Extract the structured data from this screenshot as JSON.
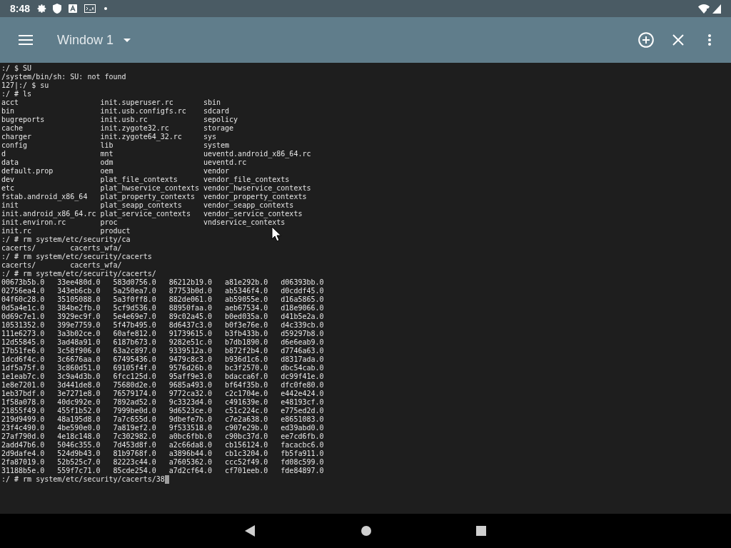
{
  "status_bar": {
    "time": "8:48"
  },
  "toolbar": {
    "title": "Window 1"
  },
  "terminal": {
    "blocks": [
      {
        "kind": "line",
        "text": ":/ $ SU"
      },
      {
        "kind": "line",
        "text": "/system/bin/sh: SU: not found"
      },
      {
        "kind": "line",
        "text": "127|:/ $ su"
      },
      {
        "kind": "line",
        "text": ":/ # ls"
      },
      {
        "kind": "listing",
        "rows": [
          [
            "acct",
            "init.superuser.rc",
            "sbin"
          ],
          [
            "bin",
            "init.usb.configfs.rc",
            "sdcard"
          ],
          [
            "bugreports",
            "init.usb.rc",
            "sepolicy"
          ],
          [
            "cache",
            "init.zygote32.rc",
            "storage"
          ],
          [
            "charger",
            "init.zygote64_32.rc",
            "sys"
          ],
          [
            "config",
            "lib",
            "system"
          ],
          [
            "d",
            "mnt",
            "ueventd.android_x86_64.rc"
          ],
          [
            "data",
            "odm",
            "ueventd.rc"
          ],
          [
            "default.prop",
            "oem",
            "vendor"
          ],
          [
            "dev",
            "plat_file_contexts",
            "vendor_file_contexts"
          ],
          [
            "etc",
            "plat_hwservice_contexts",
            "vendor_hwservice_contexts"
          ],
          [
            "fstab.android_x86_64",
            "plat_property_contexts",
            "vendor_property_contexts"
          ],
          [
            "init",
            "plat_seapp_contexts",
            "vendor_seapp_contexts"
          ],
          [
            "init.android_x86_64.rc",
            "plat_service_contexts",
            "vendor_service_contexts"
          ],
          [
            "init.environ.rc",
            "proc",
            "vndservice_contexts"
          ],
          [
            "init.rc",
            "product"
          ]
        ]
      },
      {
        "kind": "line",
        "text": ":/ # rm system/etc/security/ca"
      },
      {
        "kind": "completion",
        "rows": [
          [
            "cacerts/",
            "cacerts_wfa/"
          ]
        ]
      },
      {
        "kind": "line",
        "text": ":/ # rm system/etc/security/cacerts"
      },
      {
        "kind": "completion",
        "rows": [
          [
            "cacerts/",
            "cacerts_wfa/"
          ]
        ]
      },
      {
        "kind": "line",
        "text": ":/ # rm system/etc/security/cacerts/"
      },
      {
        "kind": "grid",
        "rows": [
          [
            "00673b5b.0",
            "33ee480d.0",
            "583d0756.0",
            "86212b19.0",
            "a81e292b.0",
            "d06393bb.0"
          ],
          [
            "02756ea4.0",
            "343eb6cb.0",
            "5a250ea7.0",
            "87753b0d.0",
            "ab5346f4.0",
            "d0cddf45.0"
          ],
          [
            "04f60c28.0",
            "35105088.0",
            "5a3f0ff8.0",
            "882de061.0",
            "ab59055e.0",
            "d16a5865.0"
          ],
          [
            "0d5a4e1c.0",
            "384be2fb.0",
            "5cf9d536.0",
            "88950faa.0",
            "aeb67534.0",
            "d18e9066.0"
          ],
          [
            "0d69c7e1.0",
            "3929ec9f.0",
            "5e4e69e7.0",
            "89c02a45.0",
            "b0ed035a.0",
            "d41b5e2a.0"
          ],
          [
            "10531352.0",
            "399e7759.0",
            "5f47b495.0",
            "8d6437c3.0",
            "b0f3e76e.0",
            "d4c339cb.0"
          ],
          [
            "111e6273.0",
            "3a3b02ce.0",
            "60afe812.0",
            "91739615.0",
            "b3fb433b.0",
            "d59297b8.0"
          ],
          [
            "12d55845.0",
            "3ad48a91.0",
            "6187b673.0",
            "9282e51c.0",
            "b7db1890.0",
            "d6e6eab9.0"
          ],
          [
            "17b51fe6.0",
            "3c58f906.0",
            "63a2c897.0",
            "9339512a.0",
            "b872f2b4.0",
            "d7746a63.0"
          ],
          [
            "1dcd6f4c.0",
            "3c6676aa.0",
            "67495436.0",
            "9479c8c3.0",
            "b936d1c6.0",
            "d8317ada.0"
          ],
          [
            "1df5a75f.0",
            "3c860d51.0",
            "69105f4f.0",
            "9576d26b.0",
            "bc3f2570.0",
            "dbc54cab.0"
          ],
          [
            "1e1eab7c.0",
            "3c9a4d3b.0",
            "6fcc125d.0",
            "95aff9e3.0",
            "bdacca6f.0",
            "dc99f41e.0"
          ],
          [
            "1e8e7201.0",
            "3d441de8.0",
            "75680d2e.0",
            "9685a493.0",
            "bf64f35b.0",
            "dfc0fe80.0"
          ],
          [
            "1eb37bdf.0",
            "3e7271e8.0",
            "76579174.0",
            "9772ca32.0",
            "c2c1704e.0",
            "e442e424.0"
          ],
          [
            "1f58a078.0",
            "40dc992e.0",
            "7892ad52.0",
            "9c3323d4.0",
            "c491639e.0",
            "e48193cf.0"
          ],
          [
            "21855f49.0",
            "455f1b52.0",
            "7999be0d.0",
            "9d6523ce.0",
            "c51c224c.0",
            "e775ed2d.0"
          ],
          [
            "219d9499.0",
            "48a195d8.0",
            "7a7c655d.0",
            "9dbefe7b.0",
            "c7e2a638.0",
            "e8651083.0"
          ],
          [
            "23f4c490.0",
            "4be590e0.0",
            "7a819ef2.0",
            "9f533518.0",
            "c907e29b.0",
            "ed39abd0.0"
          ],
          [
            "27af790d.0",
            "4e18c148.0",
            "7c302982.0",
            "a0bc6fbb.0",
            "c90bc37d.0",
            "ee7cd6fb.0"
          ],
          [
            "2add47b6.0",
            "5046c355.0",
            "7d453d8f.0",
            "a2c66da8.0",
            "cb156124.0",
            "facacbc6.0"
          ],
          [
            "2d9dafe4.0",
            "524d9b43.0",
            "81b9768f.0",
            "a3896b44.0",
            "cb1c3204.0",
            "fb5fa911.0"
          ],
          [
            "2fa87019.0",
            "52b525c7.0",
            "82223c44.0",
            "a7605362.0",
            "ccc52f49.0",
            "fd08c599.0"
          ],
          [
            "31188b5e.0",
            "559f7c71.0",
            "85cde254.0",
            "a7d2cf64.0",
            "cf701eeb.0",
            "fde84897.0"
          ]
        ]
      },
      {
        "kind": "line",
        "text": ":/ # rm system/etc/security/cacerts/38",
        "cursor": true
      }
    ]
  }
}
